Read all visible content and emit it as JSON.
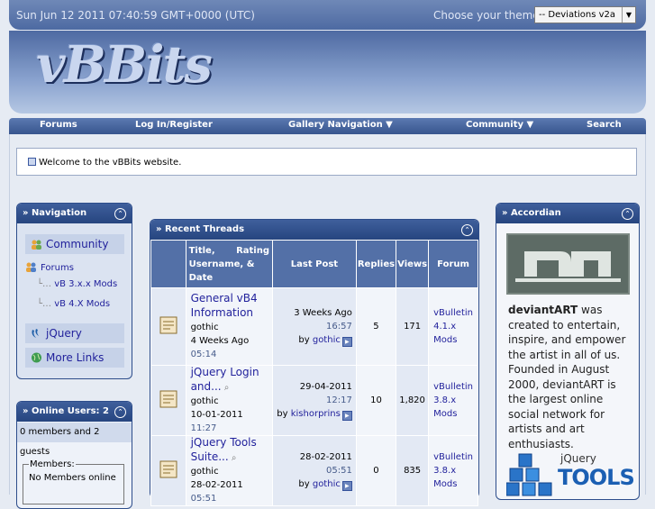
{
  "topbar": {
    "datetime": "Sun Jun 12 2011 07:40:59 GMT+0000 (UTC)",
    "theme_label": "Choose your theme:",
    "theme_value": "-- Deviations v2a",
    "theme_arrow": "▼"
  },
  "header": {
    "logo": "vBBits"
  },
  "navbar": {
    "items": [
      "Forums",
      "Log In/Register",
      "Gallery Navigation ▼",
      "Community ▼",
      "Search"
    ]
  },
  "welcome": "Welcome to the vBBits website.",
  "navigation_box": {
    "title": "» Navigation",
    "items": {
      "community": "Community",
      "forums": "Forums",
      "vb3": "vB 3.x.x Mods",
      "vb4": "vB 4.X Mods",
      "jquery": "jQuery",
      "more": "More Links"
    }
  },
  "online_box": {
    "title": "» Online Users: 2",
    "summary": "0 members and 2 guests",
    "members_legend": "Members:",
    "members_text": "No Members online"
  },
  "threads": {
    "title": "» Recent Threads",
    "headers": {
      "title_col_1": "Title,",
      "title_col_2": "Rating",
      "title_col_3": "Username, &",
      "title_col_4": "Date",
      "last_post": "Last Post",
      "replies": "Replies",
      "views": "Views",
      "forum": "Forum"
    },
    "rows": [
      {
        "title": "General vB4 Information",
        "user": "gothic",
        "date": "4 Weeks Ago",
        "time": "05:14",
        "last_date": "3 Weeks Ago",
        "last_time": "16:57",
        "by": "by",
        "last_user": "gothic",
        "replies": "5",
        "views": "171",
        "forum": "vBulletin 4.1.x Mods"
      },
      {
        "title": "jQuery Login and...",
        "user": "gothic",
        "date": "10-01-2011",
        "time": "11:27",
        "last_date": "29-04-2011",
        "last_time": "12:17",
        "by": "by",
        "last_user": "kishorprins",
        "replies": "10",
        "views": "1,820",
        "forum": "vBulletin 3.8.x Mods"
      },
      {
        "title": "jQuery Tools Suite...",
        "user": "gothic",
        "date": "28-02-2011",
        "time": "05:51",
        "last_date": "28-02-2011",
        "last_time": "05:51",
        "by": "by",
        "last_user": "gothic",
        "replies": "0",
        "views": "835",
        "forum": "vBulletin 3.8.x Mods"
      }
    ]
  },
  "accordian": {
    "title": "» Accordian",
    "brand": "deviantART",
    "text": "was created to entertain, inspire, and empower the artist in all of us. Founded in August 2000, deviantART is the largest online social network for artists and art enthusiasts.",
    "jquery_small": "jQuery",
    "jquery_big": "TOOLS"
  }
}
